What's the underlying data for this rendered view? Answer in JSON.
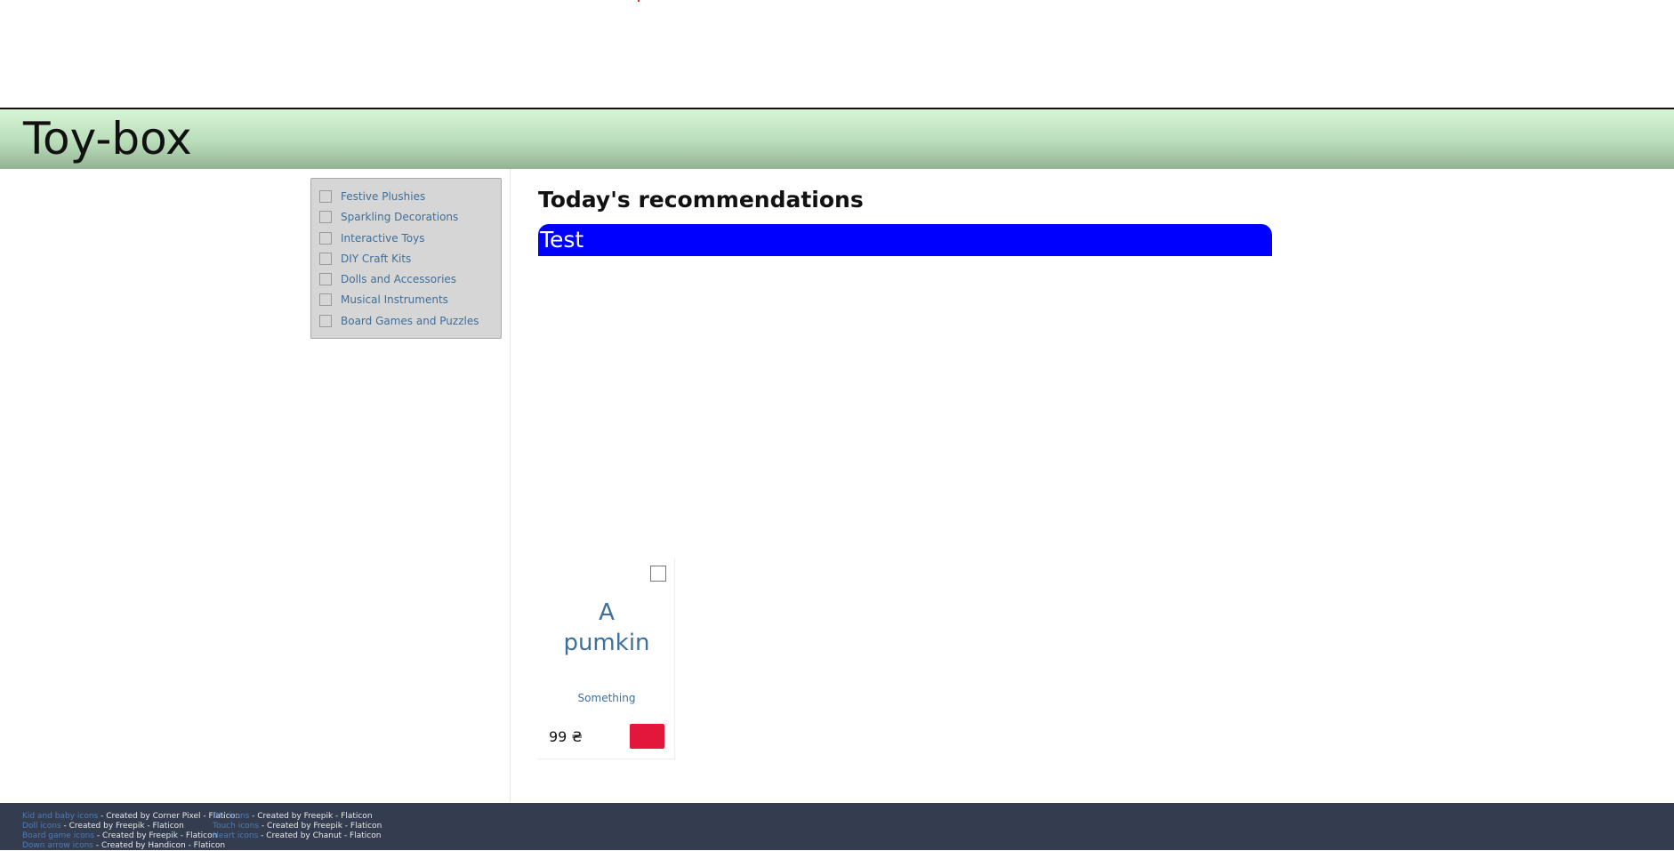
{
  "site": {
    "title": "Toy-box"
  },
  "filters": [
    {
      "label": "Festive Plushies"
    },
    {
      "label": "Sparkling Decorations"
    },
    {
      "label": "Interactive Toys"
    },
    {
      "label": "DIY Craft Kits"
    },
    {
      "label": "Dolls and Accessories"
    },
    {
      "label": "Musical Instruments"
    },
    {
      "label": "Board Games and Puzzles"
    }
  ],
  "main": {
    "heading": "Today's recommendations",
    "banner_text": "Test"
  },
  "product": {
    "name_line1": "A",
    "name_line2": "pumkin",
    "description": "Something",
    "price": "99 ₴"
  },
  "footer": {
    "credits_left": [
      {
        "link": "Kid and baby icons",
        "text": " - Created by Corner Pixel - Flaticon"
      },
      {
        "link": "Doll icons",
        "text": " - Created by Freepik - Flaticon"
      },
      {
        "link": "Board game icons",
        "text": " - Created by Freepik - Flaticon"
      },
      {
        "link": "Down arrow icons",
        "text": " - Created by Handicon - Flaticon"
      }
    ],
    "credits_right": [
      {
        "link": "DIY icons",
        "text": " - Created by Freepik - Flaticon"
      },
      {
        "link": "Touch icons",
        "text": " - Created by Freepik - Flaticon"
      },
      {
        "link": "Heart icons",
        "text": " - Created by Chanut - Flaticon"
      }
    ]
  },
  "colors": {
    "banner": "#0000ff",
    "link": "#3f6f9a",
    "buy_button": "#e3173b",
    "footer_bg": "#343d4f"
  }
}
